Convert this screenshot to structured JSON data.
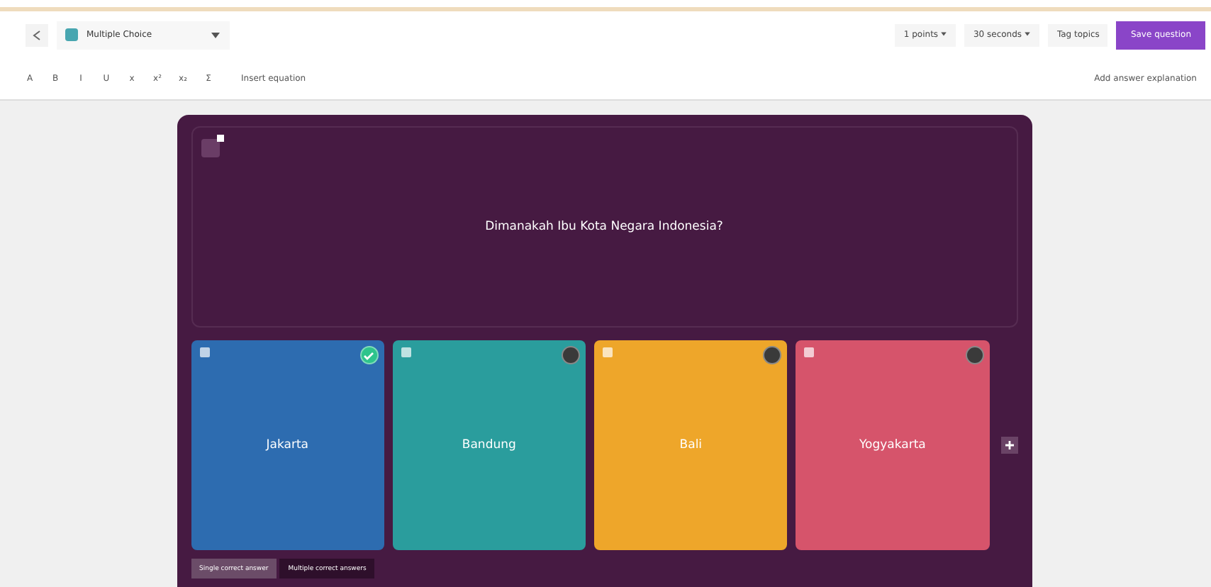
{
  "toolbar": {
    "question_type": "Multiple Choice",
    "points": "1 points",
    "time": "30 seconds",
    "tag": "Tag topics",
    "save": "Save question"
  },
  "format_bar": {
    "tools": [
      "A",
      "B",
      "I",
      "U",
      "x",
      "x²",
      "x₂",
      "Σ"
    ],
    "equation": "Insert equation",
    "explanation": "Add answer explanation"
  },
  "question": {
    "text": "Dimanakah Ibu Kota Negara Indonesia?"
  },
  "options": [
    {
      "text": "Jakarta",
      "color": "#2d6cb0",
      "correct": true
    },
    {
      "text": "Bandung",
      "color": "#2a9d9d",
      "correct": false
    },
    {
      "text": "Bali",
      "color": "#eea62a",
      "correct": false
    },
    {
      "text": "Yogyakarta",
      "color": "#d6546b",
      "correct": false
    }
  ],
  "answer_modes": [
    {
      "label": "Single correct answer",
      "selected": true
    },
    {
      "label": "Multiple correct answers",
      "selected": false
    }
  ]
}
